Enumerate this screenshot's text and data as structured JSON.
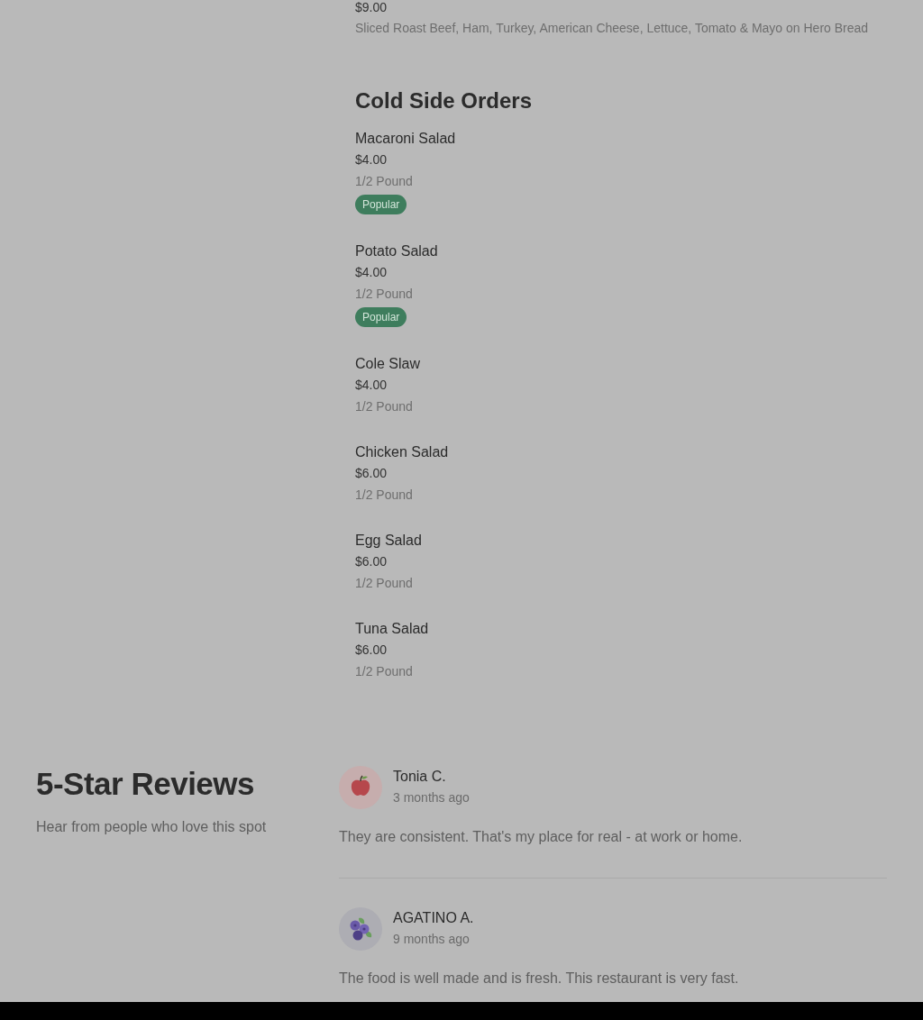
{
  "previous_item": {
    "price": "$9.00",
    "description": "Sliced Roast Beef, Ham, Turkey, American Cheese, Lettuce, Tomato & Mayo on Hero Bread"
  },
  "menu_section": {
    "title": "Cold Side Orders",
    "items": [
      {
        "name": "Macaroni Salad",
        "price": "$4.00",
        "description": "1/2 Pound",
        "badge": "Popular"
      },
      {
        "name": "Potato Salad",
        "price": "$4.00",
        "description": "1/2 Pound",
        "badge": "Popular"
      },
      {
        "name": "Cole Slaw",
        "price": "$4.00",
        "description": "1/2 Pound"
      },
      {
        "name": "Chicken Salad",
        "price": "$6.00",
        "description": "1/2 Pound"
      },
      {
        "name": "Egg Salad",
        "price": "$6.00",
        "description": "1/2 Pound"
      },
      {
        "name": "Tuna Salad",
        "price": "$6.00",
        "description": "1/2 Pound"
      }
    ]
  },
  "reviews": {
    "title": "5-Star Reviews",
    "subtitle": "Hear from people who love this spot",
    "items": [
      {
        "avatar": {
          "kind": "apple"
        },
        "name": "Tonia C.",
        "time": "3 months ago",
        "text": "They are consistent. That's my place for real - at work or home."
      },
      {
        "avatar": {
          "kind": "berries"
        },
        "name": "AGATINO A.",
        "time": "9 months ago",
        "text": "The food is well made and is fresh. This restaurant is very fast."
      }
    ]
  }
}
